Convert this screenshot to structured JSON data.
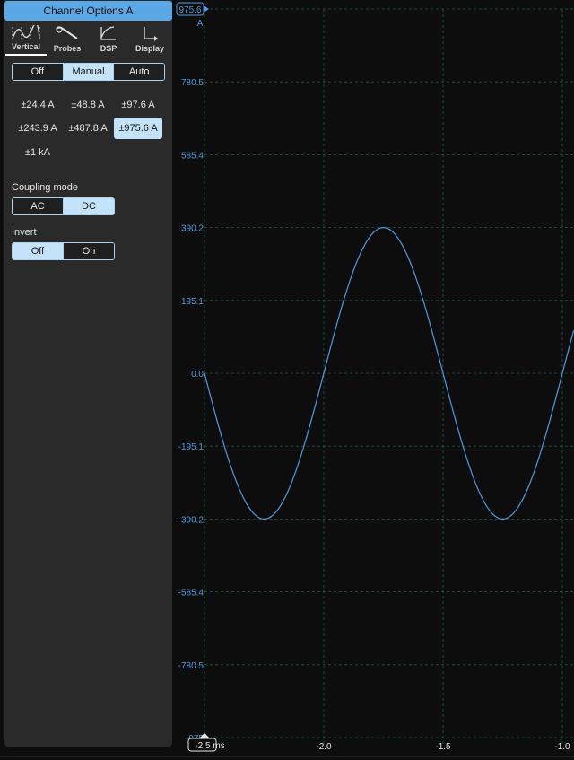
{
  "panel": {
    "title": "Channel Options  A",
    "tabs": [
      {
        "label": "Vertical",
        "icon": "vertical-icon",
        "active": true
      },
      {
        "label": "Probes",
        "icon": "probe-icon",
        "active": false
      },
      {
        "label": "DSP",
        "icon": "dsp-icon",
        "active": false
      },
      {
        "label": "Display",
        "icon": "display-icon",
        "active": false
      }
    ],
    "range_mode": {
      "options": [
        "Off",
        "Manual",
        "Auto"
      ],
      "selected": "Manual"
    },
    "ranges": [
      "±24.4 A",
      "±48.8 A",
      "±97.6 A",
      "±243.9 A",
      "±487.8 A",
      "±975.6 A",
      "±1 kA"
    ],
    "selected_range": "±975.6 A",
    "coupling": {
      "label": "Coupling mode",
      "options": [
        "AC",
        "DC"
      ],
      "selected": "DC"
    },
    "invert": {
      "label": "Invert",
      "options": [
        "Off",
        "On"
      ],
      "selected": "Off"
    }
  },
  "scope": {
    "y_unit": "A",
    "y_top_marker": "975.6",
    "y_ticks": [
      "780.5",
      "585.4",
      "390.2",
      "195.1",
      "0.0",
      "-195.1",
      "-390.2",
      "-585.4",
      "-780.5",
      "-975"
    ],
    "x_ticks": [
      "-2.0",
      "-1.5",
      "-1.0"
    ],
    "x_start_marker": "-2.5 ms",
    "trace_color": "#4f9be0"
  },
  "chart_data": {
    "type": "line",
    "xlabel": "ms",
    "ylabel": "A",
    "xlim": [
      -2.5,
      -0.95
    ],
    "ylim": [
      -975.6,
      975.6
    ],
    "grid": true,
    "series": [
      {
        "amplitude": 390.2,
        "period_ms": 1.0,
        "phase_note_zero_crossing_ms": -2.5,
        "x": [
          -2.5,
          -2.25,
          -2.0,
          -1.75,
          -1.5,
          -1.25,
          -1.0,
          -0.95
        ],
        "values": [
          0.0,
          -390.2,
          0.0,
          390.2,
          0.0,
          -390.2,
          0.0,
          120.6
        ]
      }
    ]
  }
}
